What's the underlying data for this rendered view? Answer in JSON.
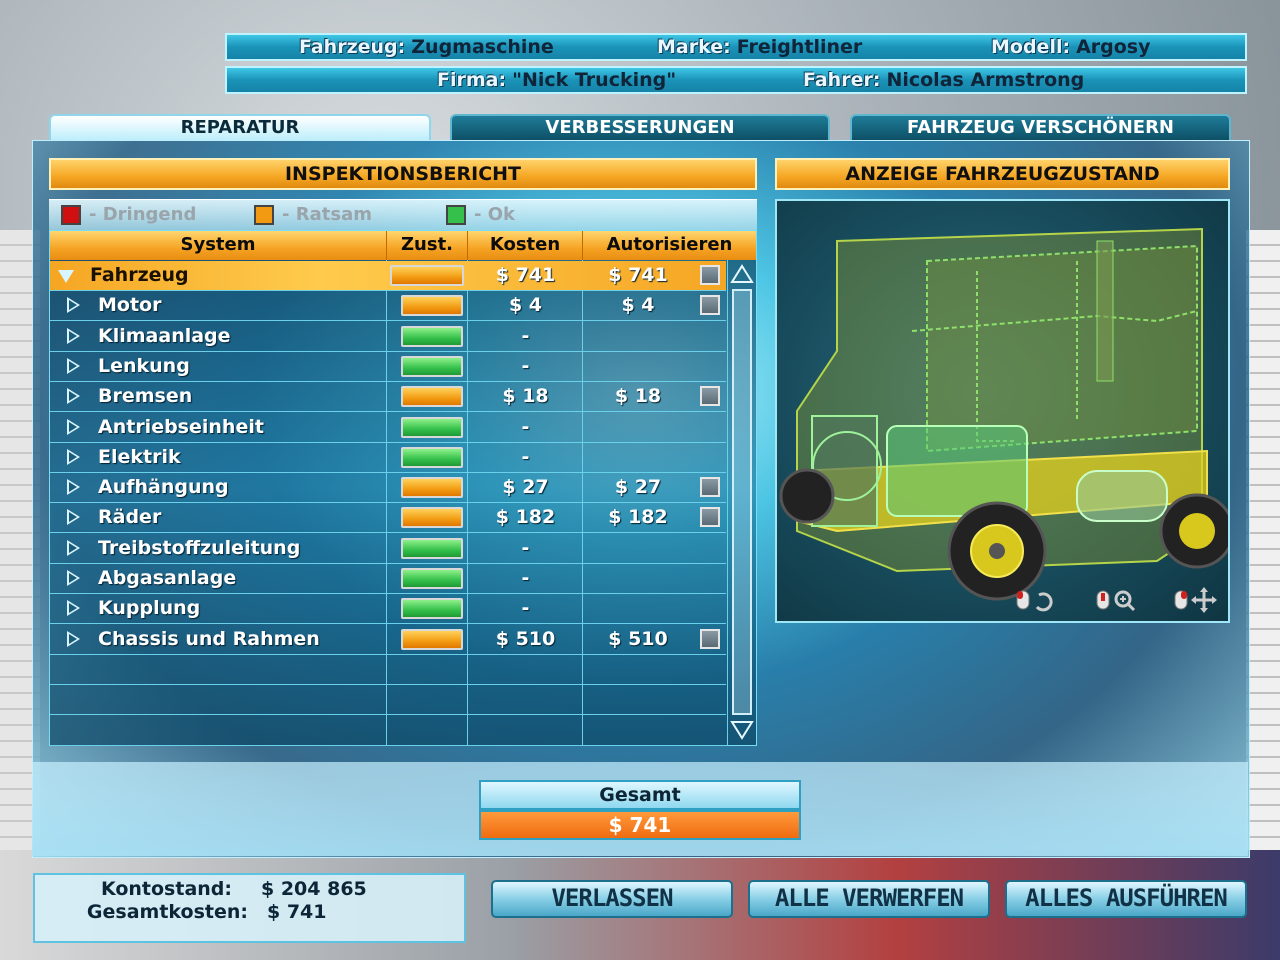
{
  "header": {
    "vehicle_label": "Fahrzeug:",
    "vehicle_value": "Zugmaschine",
    "brand_label": "Marke:",
    "brand_value": "Freightliner",
    "model_label": "Modell:",
    "model_value": "Argosy",
    "company_label": "Firma:",
    "company_value": "\"Nick Trucking\"",
    "driver_label": "Fahrer:",
    "driver_value": "Nicolas Armstrong"
  },
  "tabs": [
    {
      "label": "REPARATUR",
      "active": true
    },
    {
      "label": "VERBESSERUNGEN",
      "active": false
    },
    {
      "label": "FAHRZEUG VERSCHÖNERN",
      "active": false
    }
  ],
  "inspection": {
    "title": "INSPEKTIONSBERICHT",
    "legend": {
      "urgent": "- Dringend",
      "advisable": "- Ratsam",
      "ok": "- Ok"
    },
    "legend_colors": {
      "urgent": "#d01010",
      "advisable": "#f29b12",
      "ok": "#34c04a"
    },
    "columns": {
      "system": "System",
      "state": "Zust.",
      "cost": "Kosten",
      "authorize": "Autorisieren"
    },
    "rows": [
      {
        "name": "Fahrzeug",
        "status": "orange",
        "cost": "$ 741",
        "auth": "$ 741",
        "checkbox": true,
        "expanded": true
      },
      {
        "name": "Motor",
        "status": "orange",
        "cost": "$ 4",
        "auth": "$ 4",
        "checkbox": true
      },
      {
        "name": "Klimaanlage",
        "status": "green",
        "cost": "-",
        "auth": "",
        "checkbox": false
      },
      {
        "name": "Lenkung",
        "status": "green",
        "cost": "-",
        "auth": "",
        "checkbox": false
      },
      {
        "name": "Bremsen",
        "status": "orange",
        "cost": "$ 18",
        "auth": "$ 18",
        "checkbox": true
      },
      {
        "name": "Antriebseinheit",
        "status": "green",
        "cost": "-",
        "auth": "",
        "checkbox": false
      },
      {
        "name": "Elektrik",
        "status": "green",
        "cost": "-",
        "auth": "",
        "checkbox": false
      },
      {
        "name": "Aufhängung",
        "status": "orange",
        "cost": "$ 27",
        "auth": "$ 27",
        "checkbox": true
      },
      {
        "name": "Räder",
        "status": "orange",
        "cost": "$ 182",
        "auth": "$ 182",
        "checkbox": true
      },
      {
        "name": "Treibstoffzuleitung",
        "status": "green",
        "cost": "-",
        "auth": "",
        "checkbox": false
      },
      {
        "name": "Abgasanlage",
        "status": "green",
        "cost": "-",
        "auth": "",
        "checkbox": false
      },
      {
        "name": "Kupplung",
        "status": "green",
        "cost": "-",
        "auth": "",
        "checkbox": false
      },
      {
        "name": "Chassis und Rahmen",
        "status": "orange",
        "cost": "$ 510",
        "auth": "$ 510",
        "checkbox": true
      }
    ]
  },
  "condition": {
    "title": "ANZEIGE FAHRZEUGZUSTAND",
    "controls": [
      "mouse-rotate-icon",
      "mouse-zoom-icon",
      "mouse-move-icon"
    ]
  },
  "total": {
    "label": "Gesamt",
    "value": "$ 741"
  },
  "account": {
    "balance_label": "Kontostand:",
    "balance_value": "$ 204 865",
    "total_cost_label": "Gesamtkosten:",
    "total_cost_value": "$ 741"
  },
  "buttons": {
    "leave": "VERLASSEN",
    "discard_all": "ALLE VERWERFEN",
    "execute_all": "ALLES AUSFÜHREN"
  }
}
